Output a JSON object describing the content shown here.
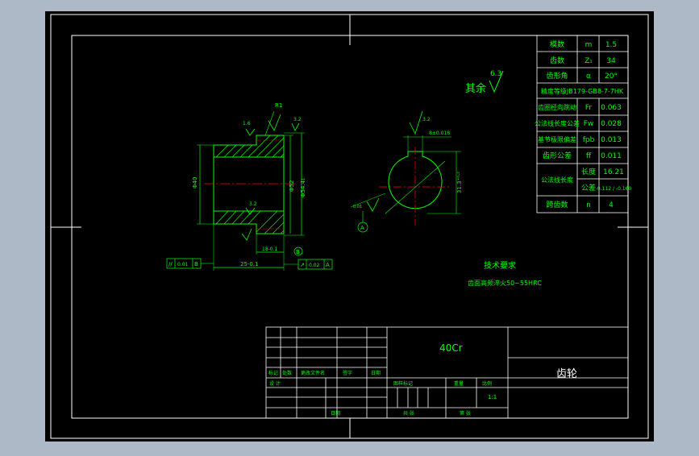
{
  "colors": {
    "background": "#000000",
    "frame": "#ffffff",
    "dim": "#00ff00",
    "centerline": "#ff0000",
    "hatch": "#00ff00",
    "text": "#00ff00",
    "title_text": "#00ff00"
  },
  "params_table": {
    "rows": [
      {
        "label": "模数",
        "symbol": "m",
        "value": "1.5"
      },
      {
        "label": "齿数",
        "symbol": "Z₁",
        "value": "34"
      },
      {
        "label": "齿形角",
        "symbol": "α",
        "value": "20°"
      },
      {
        "label": "精度等级JB179-GB8-7-7HK",
        "symbol": "",
        "value": ""
      },
      {
        "label": "齿圈径向跳动",
        "symbol": "Fr",
        "value": "0.063"
      },
      {
        "label": "公法线长度公差",
        "symbol": "Fw",
        "value": "0.028"
      },
      {
        "label": "基节极限偏差",
        "symbol": "fpb",
        "value": "0.013"
      },
      {
        "label": "齿形公差",
        "symbol": "ff",
        "value": "0.011"
      },
      {
        "label": "公法线长度",
        "symbol": "长度",
        "value": "16.21"
      },
      {
        "label": "",
        "symbol": "公差",
        "value": "-0.112 / -0.160"
      },
      {
        "label": "跨齿数",
        "symbol": "n",
        "value": "4"
      }
    ]
  },
  "roughness": {
    "rest_label": "其余",
    "rest_value": "6.3",
    "r1": "R1",
    "v1": "1.6",
    "v2": "3.2",
    "v3": "3.2",
    "v4": "3.2",
    "v5": "3.2"
  },
  "dimensions": {
    "d_left": "Φ40",
    "d_mid": "Φ52",
    "d_right": "Φ54.4₁",
    "width_bottom": "25-0.1",
    "width_small": "18-0.1",
    "key_depth": "31.3⁺⁰·²",
    "key_width": "8±0.018",
    "datum": "B",
    "datum2": "A",
    "runout_tol": "0.01",
    "tol2": "0.02",
    "tol3": "0.01",
    "ref_a": "A"
  },
  "tech": {
    "title": "技术要求",
    "line1": "齿面高频淬火50~55HRC"
  },
  "title_block": {
    "material": "40Cr",
    "part_name": "齿轮",
    "scale": "1:1",
    "col_labels": [
      "标记",
      "处数",
      "更改文件名",
      "签字",
      "日期"
    ],
    "design": "设 计",
    "std": "标准化",
    "date_label": "日期",
    "stage_labels": [
      "图样标记",
      "重量",
      "比例"
    ],
    "sheet_labels": [
      "共 张",
      "第 张"
    ]
  }
}
